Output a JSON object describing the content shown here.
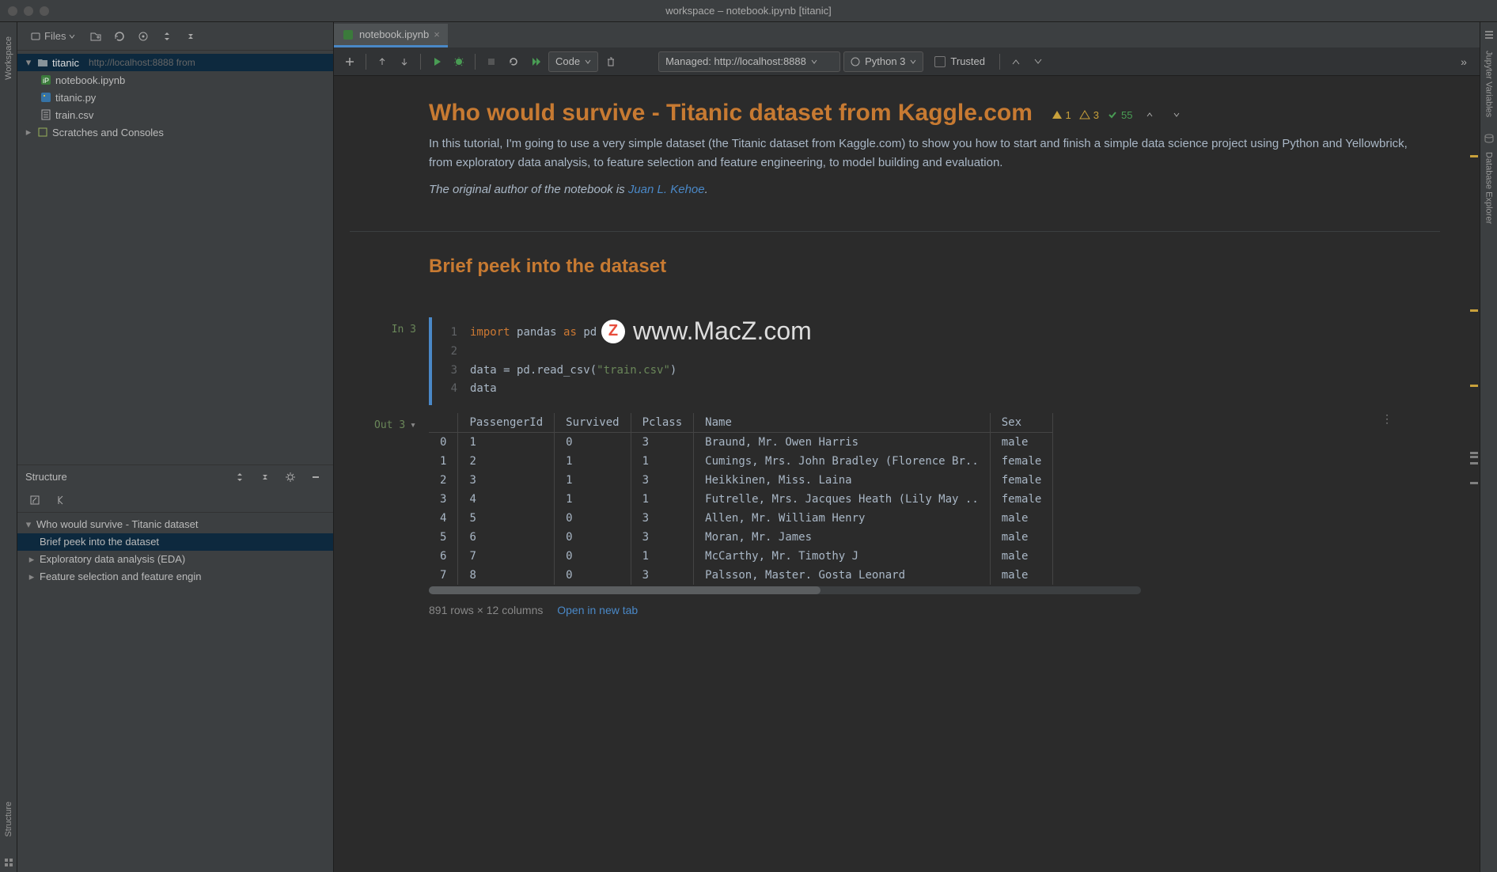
{
  "titlebar": {
    "title": "workspace – notebook.ipynb [titanic]"
  },
  "left_strip": {
    "workspace": "Workspace",
    "structure": "Structure"
  },
  "sidebar_toolbar": {
    "files_label": "Files"
  },
  "project_tree": {
    "root": {
      "name": "titanic",
      "meta": "http://localhost:8888 from"
    },
    "items": [
      {
        "name": "notebook.ipynb",
        "icon": "ipynb"
      },
      {
        "name": "titanic.py",
        "icon": "py"
      },
      {
        "name": "train.csv",
        "icon": "csv"
      }
    ],
    "scratches": "Scratches and Consoles"
  },
  "structure": {
    "title": "Structure",
    "items": [
      {
        "label": "Who would survive - Titanic dataset",
        "expanded": true,
        "depth": 0
      },
      {
        "label": "Brief peek into the dataset",
        "depth": 1,
        "selected": true
      },
      {
        "label": "Exploratory data analysis (EDA)",
        "depth": 1,
        "caret": true
      },
      {
        "label": "Feature selection and feature engin",
        "depth": 1,
        "caret": true
      }
    ]
  },
  "tabs": [
    {
      "label": "notebook.ipynb",
      "icon": "ipynb"
    }
  ],
  "nb_toolbar": {
    "cell_type": "Code",
    "managed": "Managed: http://localhost:8888",
    "kernel": "Python 3",
    "trusted": "Trusted"
  },
  "notebook": {
    "h1": "Who would survive - Titanic dataset from Kaggle.com",
    "badges": {
      "warn1": "1",
      "warn2": "3",
      "ok": "55"
    },
    "intro": "In this tutorial, I'm going to use a very simple dataset (the Titanic dataset from Kaggle.com) to show you how to start and finish a simple data science project using Python and Yellowbrick, from exploratory data analysis, to feature selection and feature engineering, to model building and evaluation.",
    "attribution_prefix": "The original author of the notebook is ",
    "attribution_link": "Juan L. Kehoe",
    "attribution_suffix": ".",
    "h2": "Brief peek into the dataset",
    "code_in_label": "In 3",
    "code_out_label": "Out 3",
    "code_lines": [
      {
        "n": "1",
        "html": "import_pandas_as_pd"
      },
      {
        "n": "2",
        "html": ""
      },
      {
        "n": "3",
        "html": "read_csv"
      },
      {
        "n": "4",
        "html": "data_line"
      }
    ],
    "df": {
      "columns": [
        "",
        "PassengerId",
        "Survived",
        "Pclass",
        "Name",
        "Sex"
      ],
      "rows": [
        [
          "0",
          "1",
          "0",
          "3",
          "Braund, Mr. Owen Harris",
          "male"
        ],
        [
          "1",
          "2",
          "1",
          "1",
          "Cumings, Mrs. John Bradley (Florence Br..",
          "female"
        ],
        [
          "2",
          "3",
          "1",
          "3",
          "Heikkinen, Miss. Laina",
          "female"
        ],
        [
          "3",
          "4",
          "1",
          "1",
          "Futrelle, Mrs. Jacques Heath (Lily May ..",
          "female"
        ],
        [
          "4",
          "5",
          "0",
          "3",
          "Allen, Mr. William Henry",
          "male"
        ],
        [
          "5",
          "6",
          "0",
          "3",
          "Moran, Mr. James",
          "male"
        ],
        [
          "6",
          "7",
          "0",
          "1",
          "McCarthy, Mr. Timothy J",
          "male"
        ],
        [
          "7",
          "8",
          "0",
          "3",
          "Palsson, Master. Gosta Leonard",
          "male"
        ]
      ],
      "caption": "891 rows × 12 columns",
      "open_link": "Open in new tab"
    }
  },
  "right_strip": {
    "jupyter": "Jupyter Variables",
    "database": "Database Explorer"
  },
  "watermark": {
    "text": "www.MacZ.com"
  }
}
